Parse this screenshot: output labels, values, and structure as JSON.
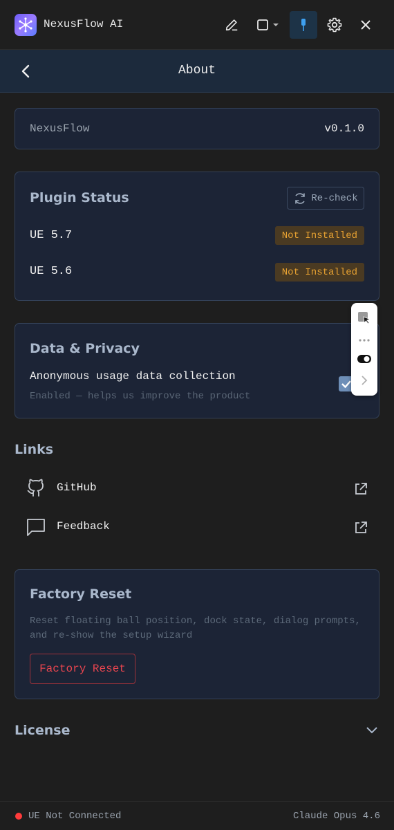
{
  "app": {
    "title": "NexusFlow AI"
  },
  "header": {
    "title": "About"
  },
  "version": {
    "name": "NexusFlow",
    "value": "v0.1.0"
  },
  "plugin_status": {
    "title": "Plugin Status",
    "recheck_label": "Re-check",
    "items": [
      {
        "label": "UE 5.7",
        "status": "Not Installed"
      },
      {
        "label": "UE 5.6",
        "status": "Not Installed"
      }
    ]
  },
  "privacy": {
    "title": "Data & Privacy",
    "main": "Anonymous usage data collection",
    "sub": "Enabled — helps us improve the product",
    "checked": true
  },
  "links": {
    "title": "Links",
    "items": [
      {
        "label": "GitHub",
        "icon": "github-icon"
      },
      {
        "label": "Feedback",
        "icon": "chat-bubble-icon"
      }
    ]
  },
  "factory_reset": {
    "title": "Factory Reset",
    "description": "Reset floating ball position, dock state, dialog prompts, and re-show the setup wizard",
    "button_label": "Factory Reset"
  },
  "license": {
    "title": "License"
  },
  "status": {
    "connection": "UE Not Connected",
    "model": "Claude Opus 4.6"
  },
  "colors": {
    "background": "#1e1e1e",
    "card": "#1c2436",
    "header": "#1c2a3c",
    "warning": "#e8a232",
    "danger": "#e8454f",
    "status_error": "#ff3b3b"
  }
}
